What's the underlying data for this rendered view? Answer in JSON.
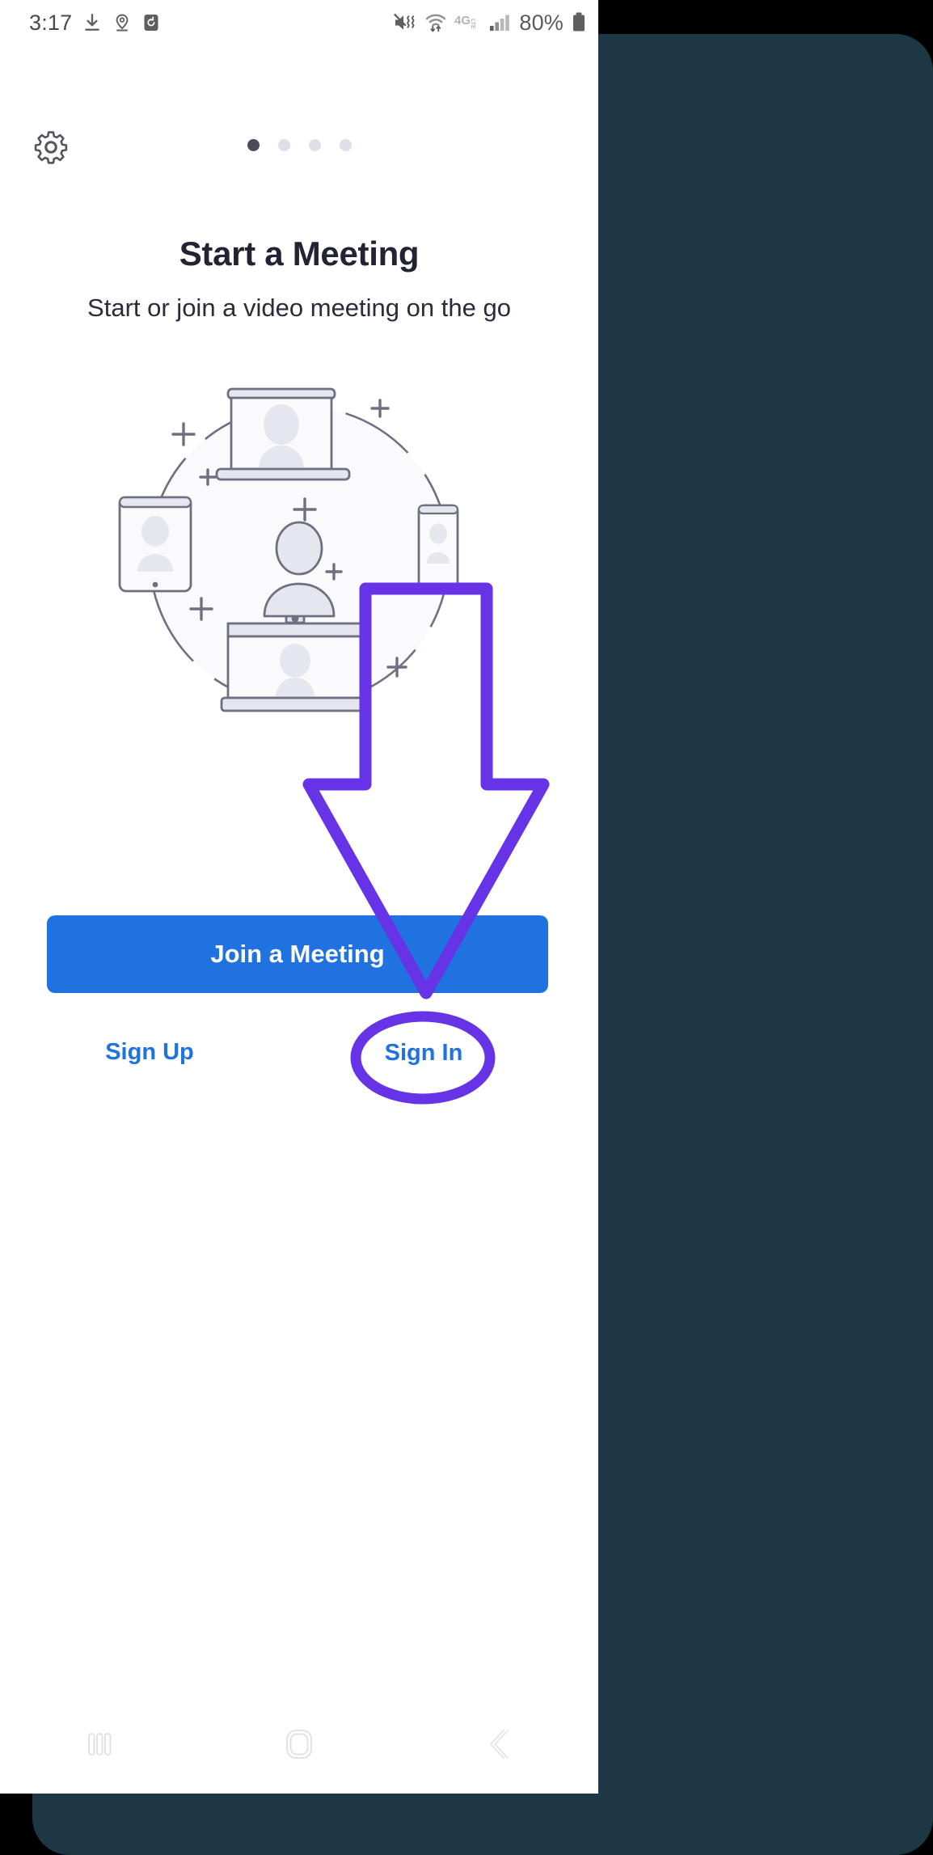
{
  "statusbar": {
    "time": "3:17",
    "battery_percent": "80%",
    "network_label": "4G",
    "network_sub": "LTE",
    "icons": [
      "download-icon",
      "location-icon",
      "sync-icon",
      "vibrate-mute-icon",
      "wifi-icon",
      "lte-icon",
      "signal-bars-icon",
      "battery-icon"
    ]
  },
  "header": {
    "settings_icon": "gear-icon",
    "pager": {
      "count": 4,
      "active_index": 0
    }
  },
  "content": {
    "title": "Start a Meeting",
    "subtitle": "Start or join a video meeting on the go",
    "illustration": {
      "name": "devices-video-meeting-illustration",
      "elements": [
        "laptop-with-avatar",
        "tablet-with-avatar",
        "phone-with-avatar",
        "monitor-with-avatar",
        "center-person-avatar",
        "dashed-circle",
        "plus-marks"
      ]
    }
  },
  "actions": {
    "join_label": "Join a Meeting",
    "signup_label": "Sign Up",
    "signin_label": "Sign In"
  },
  "annotation": {
    "arrow": "purple-down-arrow",
    "highlight": "purple-ellipse-around-sign-in",
    "color": "#6633e6"
  },
  "navbar": {
    "recents": "recents-icon",
    "home": "home-icon",
    "back": "back-icon"
  },
  "colors": {
    "primary_blue": "#1f72e0",
    "annotation_purple": "#6633e6",
    "title_dark": "#232333",
    "backdrop_teal": "#1e3745",
    "illustration_stroke": "#6f6f82",
    "illustration_fill": "#e6e6ee"
  }
}
